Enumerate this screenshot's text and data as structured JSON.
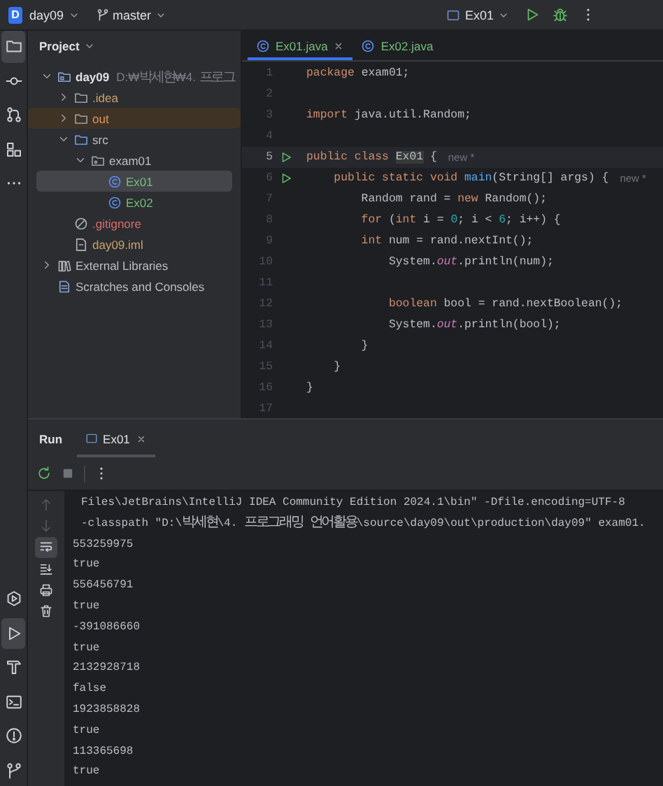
{
  "title_bar": {
    "project_badge": "D",
    "project": "day09",
    "branch": "master",
    "run_config": "Ex01"
  },
  "tool_strip": {
    "top": [
      {
        "kind": "folder",
        "selected": true
      },
      {
        "kind": "commit",
        "selected": false
      },
      {
        "kind": "pull-requests",
        "selected": false
      },
      {
        "kind": "structure",
        "selected": false
      },
      {
        "kind": "more",
        "selected": false
      }
    ],
    "bottom": [
      {
        "kind": "services",
        "selected": false
      },
      {
        "kind": "run",
        "selected": true
      },
      {
        "kind": "build",
        "selected": false
      },
      {
        "kind": "terminal",
        "selected": false
      },
      {
        "kind": "problems",
        "selected": false
      },
      {
        "kind": "git",
        "selected": false
      }
    ]
  },
  "project_panel": {
    "title": "Project",
    "items": [
      {
        "label": "day09",
        "path": "D:₩박세현₩4. 프로그",
        "kind": "module",
        "color": "#dfe1e5",
        "expanded": true,
        "selected": false,
        "excluded": false,
        "children": [
          {
            "label": ".idea",
            "kind": "folder",
            "color": "#c9a26d",
            "expanded": false,
            "selected": false,
            "excluded": false
          },
          {
            "label": "out",
            "kind": "folder",
            "color": "#e0955d",
            "expanded": false,
            "selected": false,
            "excluded": true
          },
          {
            "label": "src",
            "kind": "source-folder",
            "color": "#bcbec4",
            "expanded": true,
            "selected": false,
            "excluded": false,
            "children": [
              {
                "label": "exam01",
                "kind": "package",
                "color": "#bcbec4",
                "expanded": true,
                "selected": false,
                "excluded": false,
                "children": [
                  {
                    "label": "Ex01",
                    "kind": "class",
                    "color": "#73bd79",
                    "selected": true,
                    "excluded": false
                  },
                  {
                    "label": "Ex02",
                    "kind": "class",
                    "color": "#73bd79",
                    "selected": false,
                    "excluded": false
                  }
                ]
              }
            ]
          },
          {
            "label": ".gitignore",
            "kind": "ignore",
            "color": "#d96b6b",
            "selected": false,
            "excluded": false
          },
          {
            "label": "day09.iml",
            "kind": "file",
            "color": "#c9a26d",
            "selected": false,
            "excluded": false
          }
        ]
      },
      {
        "label": "External Libraries",
        "kind": "library",
        "color": "#bcbec4",
        "expanded": false,
        "selected": false,
        "excluded": false
      },
      {
        "label": "Scratches and Consoles",
        "kind": "scratches",
        "color": "#bcbec4",
        "selected": false,
        "excluded": false
      }
    ]
  },
  "editor": {
    "tabs": [
      {
        "label": "Ex01.java",
        "selected": true,
        "closable": true
      },
      {
        "label": "Ex02.java",
        "selected": false,
        "closable": false
      }
    ],
    "lines": [
      {
        "number": "1",
        "run_marker": false,
        "current": false,
        "tokens": [
          {
            "kind": "keyword",
            "text": "package"
          },
          {
            "kind": "plain",
            "text": " exam01;"
          }
        ]
      },
      {
        "number": "2",
        "run_marker": false,
        "current": false
      },
      {
        "number": "3",
        "run_marker": false,
        "current": false,
        "tokens": [
          {
            "kind": "keyword",
            "text": "import"
          },
          {
            "kind": "plain",
            "text": " java.util.Random;"
          }
        ]
      },
      {
        "number": "4",
        "run_marker": false,
        "current": false
      },
      {
        "number": "5",
        "run_marker": true,
        "current": true,
        "tokens": [
          {
            "kind": "keyword",
            "text": "public class "
          },
          {
            "kind": "class-usage",
            "text": "Ex01"
          },
          {
            "kind": "plain",
            "text": " {"
          }
        ],
        "hint": "new *"
      },
      {
        "number": "6",
        "run_marker": true,
        "current": false,
        "tokens": [
          {
            "kind": "keyword",
            "text": "    public static void "
          },
          {
            "kind": "method",
            "text": "main"
          },
          {
            "kind": "plain",
            "text": "(String[] args) {"
          }
        ],
        "hint": "new *"
      },
      {
        "number": "7",
        "run_marker": false,
        "current": false,
        "tokens": [
          {
            "kind": "plain",
            "text": "        Random rand = "
          },
          {
            "kind": "keyword",
            "text": "new"
          },
          {
            "kind": "plain",
            "text": " Random();"
          }
        ]
      },
      {
        "number": "8",
        "run_marker": false,
        "current": false,
        "tokens": [
          {
            "kind": "keyword",
            "text": "        for"
          },
          {
            "kind": "plain",
            "text": " ("
          },
          {
            "kind": "keyword",
            "text": "int"
          },
          {
            "kind": "plain",
            "text": " i = "
          },
          {
            "kind": "number",
            "text": "0"
          },
          {
            "kind": "plain",
            "text": "; i < "
          },
          {
            "kind": "number",
            "text": "6"
          },
          {
            "kind": "plain",
            "text": "; i++) {"
          }
        ]
      },
      {
        "number": "9",
        "run_marker": false,
        "current": false,
        "tokens": [
          {
            "kind": "keyword",
            "text": "        int"
          },
          {
            "kind": "plain",
            "text": " num = rand.nextInt();"
          }
        ]
      },
      {
        "number": "10",
        "run_marker": false,
        "current": false,
        "tokens": [
          {
            "kind": "plain",
            "text": "            System."
          },
          {
            "kind": "field",
            "text": "out"
          },
          {
            "kind": "plain",
            "text": ".println(num);"
          }
        ]
      },
      {
        "number": "11",
        "run_marker": false,
        "current": false
      },
      {
        "number": "12",
        "run_marker": false,
        "current": false,
        "tokens": [
          {
            "kind": "keyword",
            "text": "            boolean"
          },
          {
            "kind": "plain",
            "text": " bool = rand.nextBoolean();"
          }
        ]
      },
      {
        "number": "13",
        "run_marker": false,
        "current": false,
        "tokens": [
          {
            "kind": "plain",
            "text": "            System."
          },
          {
            "kind": "field",
            "text": "out"
          },
          {
            "kind": "plain",
            "text": ".println(bool);"
          }
        ]
      },
      {
        "number": "14",
        "run_marker": false,
        "current": false,
        "tokens": [
          {
            "kind": "plain",
            "text": "        }"
          }
        ]
      },
      {
        "number": "15",
        "run_marker": false,
        "current": false,
        "tokens": [
          {
            "kind": "plain",
            "text": "    }"
          }
        ]
      },
      {
        "number": "16",
        "run_marker": false,
        "current": false,
        "tokens": [
          {
            "kind": "plain",
            "text": "}"
          }
        ]
      },
      {
        "number": "17",
        "run_marker": false,
        "current": false
      }
    ]
  },
  "run_panel": {
    "title": "Run",
    "tabs": [
      {
        "label": "Ex01",
        "selected": true,
        "closable": true
      }
    ],
    "side_tools": [
      {
        "kind": "arrow-up",
        "selected": false,
        "disabled": true
      },
      {
        "kind": "arrow-down",
        "selected": false,
        "disabled": true
      },
      {
        "kind": "soft-wrap",
        "selected": true,
        "disabled": false
      },
      {
        "kind": "scroll-end",
        "selected": false,
        "disabled": false
      },
      {
        "kind": "print",
        "selected": false,
        "disabled": false
      },
      {
        "kind": "trash",
        "selected": false,
        "disabled": false
      }
    ],
    "console": [
      {
        "kind": "command",
        "text": "Files\\JetBrains\\IntelliJ IDEA Community Edition 2024.1\\bin\" -Dfile.encoding=UTF-8"
      },
      {
        "kind": "command",
        "text": "-classpath \"D:\\박세현\\4. 프로그래밍 언어활용\\source\\day09\\out\\production\\day09\" exam01."
      },
      {
        "kind": "output",
        "text": "553259975"
      },
      {
        "kind": "output",
        "text": "true"
      },
      {
        "kind": "output",
        "text": "556456791"
      },
      {
        "kind": "output",
        "text": "true"
      },
      {
        "kind": "output",
        "text": "-391086660"
      },
      {
        "kind": "output",
        "text": "true"
      },
      {
        "kind": "output",
        "text": "2132928718"
      },
      {
        "kind": "output",
        "text": "false"
      },
      {
        "kind": "output",
        "text": "1923858828"
      },
      {
        "kind": "output",
        "text": "true"
      },
      {
        "kind": "output",
        "text": "113365698"
      },
      {
        "kind": "output",
        "text": "true"
      }
    ]
  }
}
